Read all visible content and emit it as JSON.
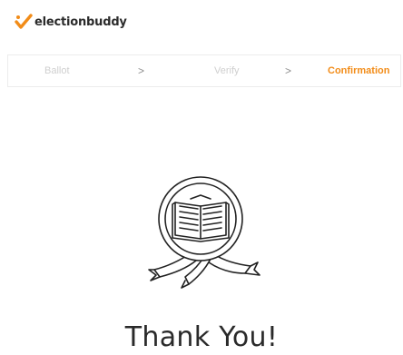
{
  "brand": {
    "name": "electionbuddy",
    "accent_color": "#f28c18",
    "icon": "checkmark-logo-icon"
  },
  "steps": {
    "items": [
      {
        "label": "Ballot",
        "state": "completed"
      },
      {
        "label": "Verify",
        "state": "completed"
      },
      {
        "label": "Confirmation",
        "state": "active"
      }
    ],
    "separator": ">"
  },
  "confirmation": {
    "icon": "ballot-book-seal-icon",
    "title": "Thank You!"
  }
}
